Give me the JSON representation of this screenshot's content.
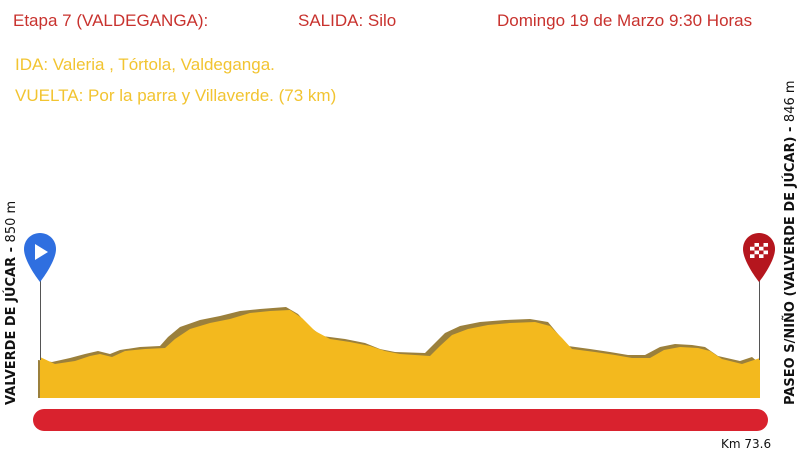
{
  "header": {
    "stage": "Etapa 7  (VALDEGANGA):",
    "departure": "SALIDA: Silo",
    "date": "Domingo 19 de Marzo 9:30 Horas"
  },
  "route": {
    "outbound": "IDA: Valeria , Tórtola, Valdeganga.",
    "return": "VUELTA: Por la parra y Villaverde. (73 km)"
  },
  "start": {
    "name": "VALVERDE DE JÚCAR",
    "altitude": "850 m",
    "icon": "play-icon"
  },
  "finish": {
    "name": "PASEO S/NIÑO (VALVERDE DE JÚCAR)",
    "altitude": "846 m",
    "icon": "checkered-flag-icon"
  },
  "distance_label": "Km 73.6",
  "colors": {
    "header": "#c8322e",
    "route_text": "#f2c431",
    "profile_fill": "#f3b91e",
    "profile_shadow": "#8a6a1a",
    "distance_bar": "#d9222e",
    "start_marker": "#2f6fe0",
    "finish_marker": "#b5161e"
  }
}
